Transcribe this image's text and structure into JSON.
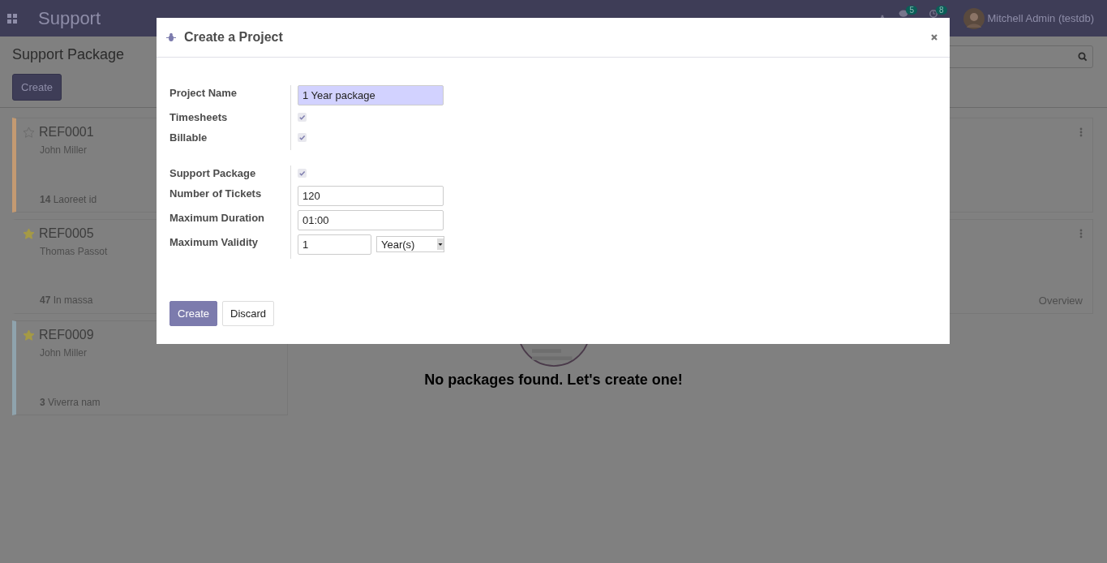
{
  "navbar": {
    "app_name": "Support",
    "systray": [
      {
        "kind": "debug"
      },
      {
        "kind": "messages",
        "badge": "5"
      },
      {
        "kind": "activities",
        "badge": "8"
      }
    ],
    "user": "Mitchell Admin (testdb)"
  },
  "control_panel": {
    "breadcrumb": "Support Package",
    "create_button": "Create"
  },
  "cards": [
    {
      "ref": "REF0001",
      "starred": false,
      "customer": "John Miller",
      "count": "14",
      "summary": "Laoreet id",
      "color": "#c49a72"
    },
    {
      "ref": "REF0005",
      "starred": true,
      "customer": "Thomas Passot",
      "count": "47",
      "summary": "In massa",
      "link": "Overview"
    },
    {
      "ref": "REF0009",
      "starred": true,
      "customer": "John Miller",
      "count": "3",
      "summary": "Viverra nam",
      "color": "#8fa3ad"
    }
  ],
  "empty_state": {
    "message": "No packages found. Let's create one!"
  },
  "dialog": {
    "title": "Create a Project",
    "groups": [
      [
        {
          "label": "Project Name",
          "kind": "text",
          "value": "1 Year package",
          "required": true
        },
        {
          "label": "Timesheets",
          "kind": "checkbox",
          "checked": true
        },
        {
          "label": "Billable",
          "kind": "checkbox",
          "checked": true
        }
      ],
      [
        {
          "label": "Support Package",
          "kind": "checkbox",
          "checked": true
        },
        {
          "label": "Number of Tickets",
          "kind": "text",
          "value": "120",
          "required": false
        },
        {
          "label": "Maximum Duration",
          "kind": "text",
          "value": "01:00",
          "required": false
        },
        {
          "label": "Maximum Validity",
          "kind": "number_unit",
          "value": "1",
          "unit": "Year(s)"
        }
      ]
    ],
    "buttons": [
      {
        "label": "Create",
        "kind": "primary"
      },
      {
        "label": "Discard",
        "kind": "secondary"
      }
    ]
  }
}
